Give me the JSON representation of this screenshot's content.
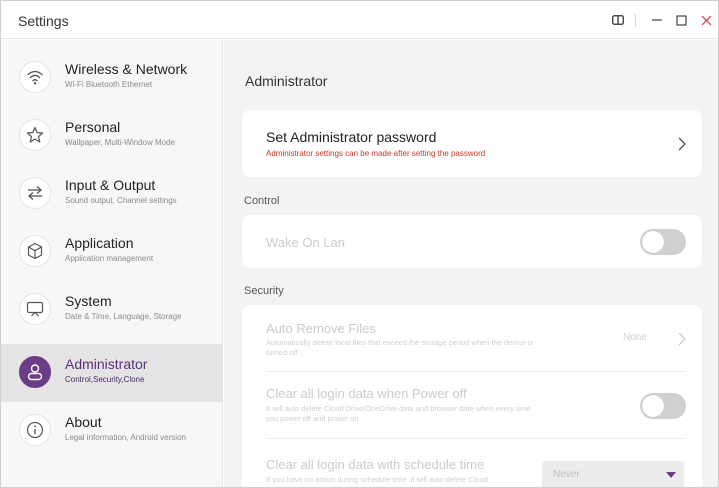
{
  "window": {
    "title": "Settings"
  },
  "sidebar": {
    "items": [
      {
        "title": "Wireless & Network",
        "subtitle": "Wi-Fi Bluetooth Ethernet",
        "icon": "wifi-icon"
      },
      {
        "title": "Personal",
        "subtitle": "Wallpaper, Multi-Window Mode",
        "icon": "star-icon"
      },
      {
        "title": "Input & Output",
        "subtitle": "Sound output, Channel settings",
        "icon": "swap-arrows-icon"
      },
      {
        "title": "Application",
        "subtitle": "Application management",
        "icon": "cube-icon"
      },
      {
        "title": "System",
        "subtitle": "Date & Time, Language, Storage",
        "icon": "monitor-icon"
      },
      {
        "title": "Administrator",
        "subtitle": "Control,Security,Clone",
        "icon": "user-icon",
        "active": true
      },
      {
        "title": "About",
        "subtitle": "Legal information, Android version",
        "icon": "info-icon"
      }
    ]
  },
  "main": {
    "page_title": "Administrator",
    "password_card": {
      "title": "Set Administrator password",
      "description": "Administrator settings can be made after setting the password"
    },
    "control": {
      "label": "Control",
      "wake_on_lan": {
        "title": "Wake On Lan",
        "enabled": false
      }
    },
    "security": {
      "label": "Security",
      "auto_remove": {
        "title": "Auto Remove Files",
        "description": "Automatically delete local files that exceed the storage period when the device is turned off",
        "value": "None"
      },
      "clear_power_off": {
        "title": "Clear all login data when Power off",
        "description": "It will auto delete Cloud Drive/OneDrive data and browser date when every time you power off and power on",
        "enabled": false
      },
      "clear_schedule": {
        "title": "Clear all login data with schedule time",
        "description": "If you have no action during schedule time ,it will auto delete Cloud",
        "selected": "Never"
      }
    }
  },
  "colors": {
    "accent": "#6a3d86",
    "warning_text": "#c0392b",
    "close_button": "#d9534f"
  }
}
